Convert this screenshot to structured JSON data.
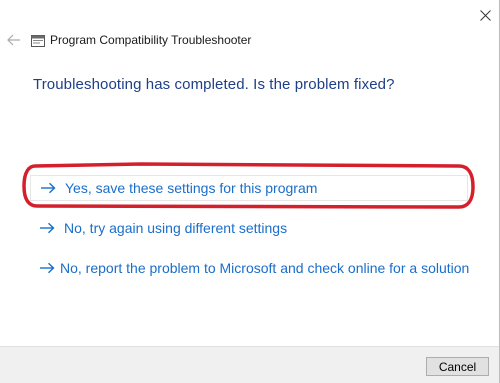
{
  "window": {
    "title": "Program Compatibility Troubleshooter"
  },
  "main": {
    "heading": "Troubleshooting has completed.  Is the problem fixed?",
    "options": [
      {
        "label": "Yes, save these settings for this program",
        "icon": "arrow-right-icon"
      },
      {
        "label": "No, try again using different settings",
        "icon": "arrow-right-icon"
      },
      {
        "label": "No, report the problem to Microsoft and check online for a solution",
        "icon": "arrow-right-icon"
      }
    ]
  },
  "footer": {
    "cancel_label": "Cancel"
  },
  "colors": {
    "heading": "#1e3f87",
    "link": "#1a6ec9",
    "highlight": "#d4202c",
    "footer_bg": "#f0f0f0"
  },
  "icons": {
    "close": "close-icon",
    "back": "back-arrow-icon",
    "app": "troubleshooter-app-icon"
  }
}
